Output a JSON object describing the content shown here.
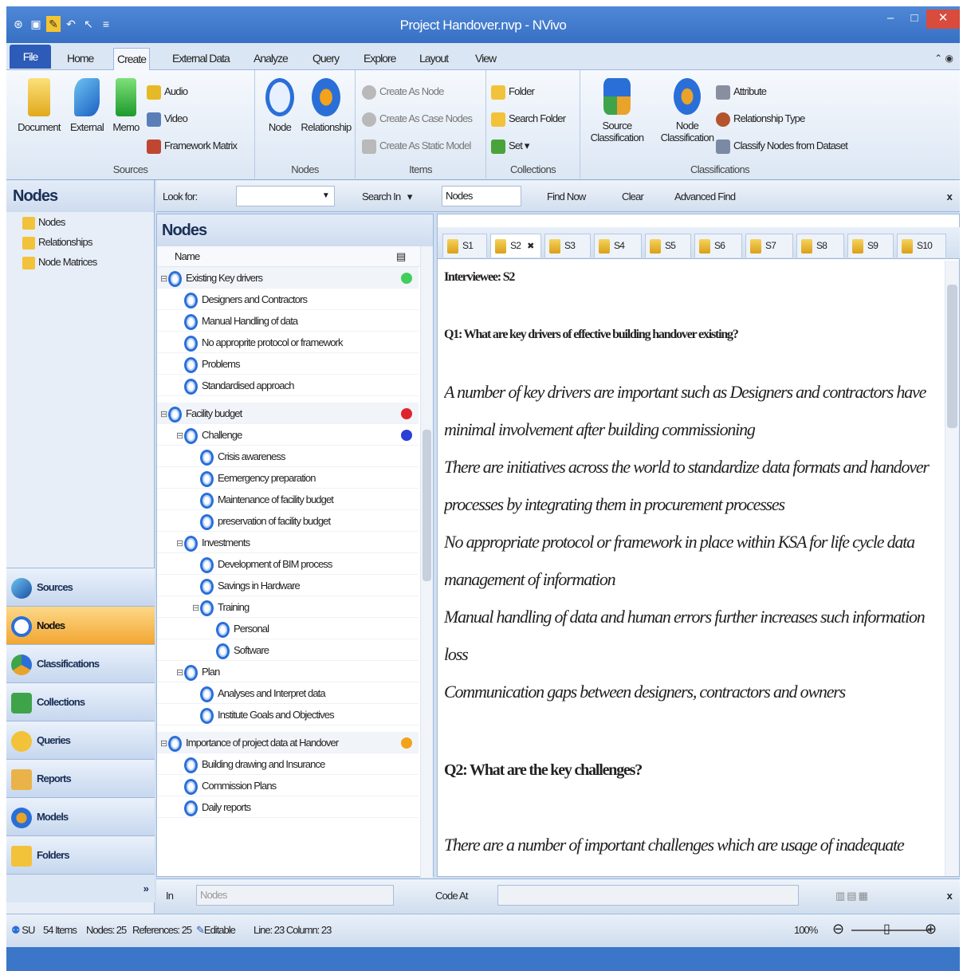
{
  "window": {
    "title": "Project Handover.nvp - NVivo",
    "accent": "#3770c4"
  },
  "tabs": [
    "File",
    "Home",
    "Create",
    "External Data",
    "Analyze",
    "Query",
    "Explore",
    "Layout",
    "View"
  ],
  "ribbon": {
    "sources": {
      "label": "Sources",
      "document": "Document",
      "external": "External",
      "memo": "Memo",
      "audio": "Audio",
      "video": "Video",
      "framework": "Framework Matrix"
    },
    "nodes": {
      "label": "Nodes",
      "node": "Node",
      "relationship": "Relationship"
    },
    "items": {
      "label": "Items",
      "as_node": "Create As Node",
      "as_case": "Create As Case Nodes",
      "as_static": "Create As Static Model"
    },
    "collections": {
      "label": "Collections",
      "folder": "Folder",
      "search_folder": "Search Folder",
      "set": "Set"
    },
    "classifications": {
      "label": "Classifications",
      "source_class": "Source",
      "source_class2": "Classification",
      "node_class": "Node",
      "node_class2": "Classification",
      "attribute": "Attribute",
      "rel_type": "Relationship Type",
      "classify": "Classify Nodes from Dataset"
    }
  },
  "navpane": {
    "title": "Nodes",
    "items": [
      "Nodes",
      "Relationships",
      "Node Matrices"
    ],
    "buttons": [
      "Sources",
      "Nodes",
      "Classifications",
      "Collections",
      "Queries",
      "Reports",
      "Models",
      "Folders"
    ]
  },
  "findbar": {
    "look_for": "Look for:",
    "search_in": "Search In",
    "search_value": "Nodes",
    "find_now": "Find Now",
    "clear": "Clear",
    "advanced": "Advanced Find",
    "close": "x"
  },
  "list": {
    "title": "Nodes",
    "col_name": "Name",
    "rows": [
      {
        "label": "Existing Key drivers",
        "level": 0,
        "exp": "⊟",
        "dot": "#3fcf5a"
      },
      {
        "label": "Designers and Contractors",
        "level": 1
      },
      {
        "label": "Manual Handling of data",
        "level": 1
      },
      {
        "label": "No approprite protocol or framework",
        "level": 1
      },
      {
        "label": "Problems",
        "level": 1
      },
      {
        "label": "Standardised approach",
        "level": 1
      },
      {
        "label": "Facility budget",
        "level": 0,
        "exp": "⊟",
        "dot": "#e0242e"
      },
      {
        "label": "Challenge",
        "level": 1,
        "exp": "⊟",
        "dot": "#2a3fd6"
      },
      {
        "label": "Crisis awareness",
        "level": 2
      },
      {
        "label": "Eemergency preparation",
        "level": 2
      },
      {
        "label": "Maintenance of facility budget",
        "level": 2
      },
      {
        "label": "preservation of facility budget",
        "level": 2
      },
      {
        "label": "Investments",
        "level": 1,
        "exp": "⊟"
      },
      {
        "label": "Development of BIM process",
        "level": 2
      },
      {
        "label": "Savings in Hardware",
        "level": 2
      },
      {
        "label": "Training",
        "level": 2,
        "exp": "⊟"
      },
      {
        "label": "Personal",
        "level": 3
      },
      {
        "label": "Software",
        "level": 3
      },
      {
        "label": "Plan",
        "level": 1,
        "exp": "⊟"
      },
      {
        "label": "Analyses and Interpret data",
        "level": 2
      },
      {
        "label": "Institute Goals and Objectives",
        "level": 2
      },
      {
        "label": "Importance of project data at Handover",
        "level": 0,
        "exp": "⊟",
        "dot": "#f2a21b"
      },
      {
        "label": "Building drawing and Insurance",
        "level": 1
      },
      {
        "label": "Commission Plans",
        "level": 1
      },
      {
        "label": "Daily reports",
        "level": 1
      }
    ]
  },
  "doctabs": [
    "S1",
    "S2",
    "S3",
    "S4",
    "S5",
    "S6",
    "S7",
    "S8",
    "S9",
    "S10"
  ],
  "document": {
    "interviewee": "Interviewee: S2",
    "q1": "Q1: What are key drivers of effective building handover existing?",
    "lines": [
      "A number of key drivers are important such as Designers and contractors have",
      "minimal involvement after building commissioning",
      "There are initiatives across the world to standardize data formats and handover",
      "processes by integrating them in procurement processes",
      "No appropriate protocol or framework in place within KSA for life cycle data",
      "management of information",
      "Manual handling of data and human errors further increases such information",
      "loss",
      "Communication gaps between designers, contractors and owners"
    ],
    "q2": "Q2: What are the key challenges?",
    "last": "There are a number of important challenges which are  usage of inadequate"
  },
  "codebar": {
    "in": "In",
    "in_value": "Nodes",
    "code_at": "Code At",
    "close": "x"
  },
  "status": {
    "user": "SU",
    "items": "54 Items",
    "nodes": "Nodes: 25",
    "references": "References: 25",
    "editable": "Editable",
    "position": "Line: 23 Column: 23",
    "zoom": "100%"
  }
}
